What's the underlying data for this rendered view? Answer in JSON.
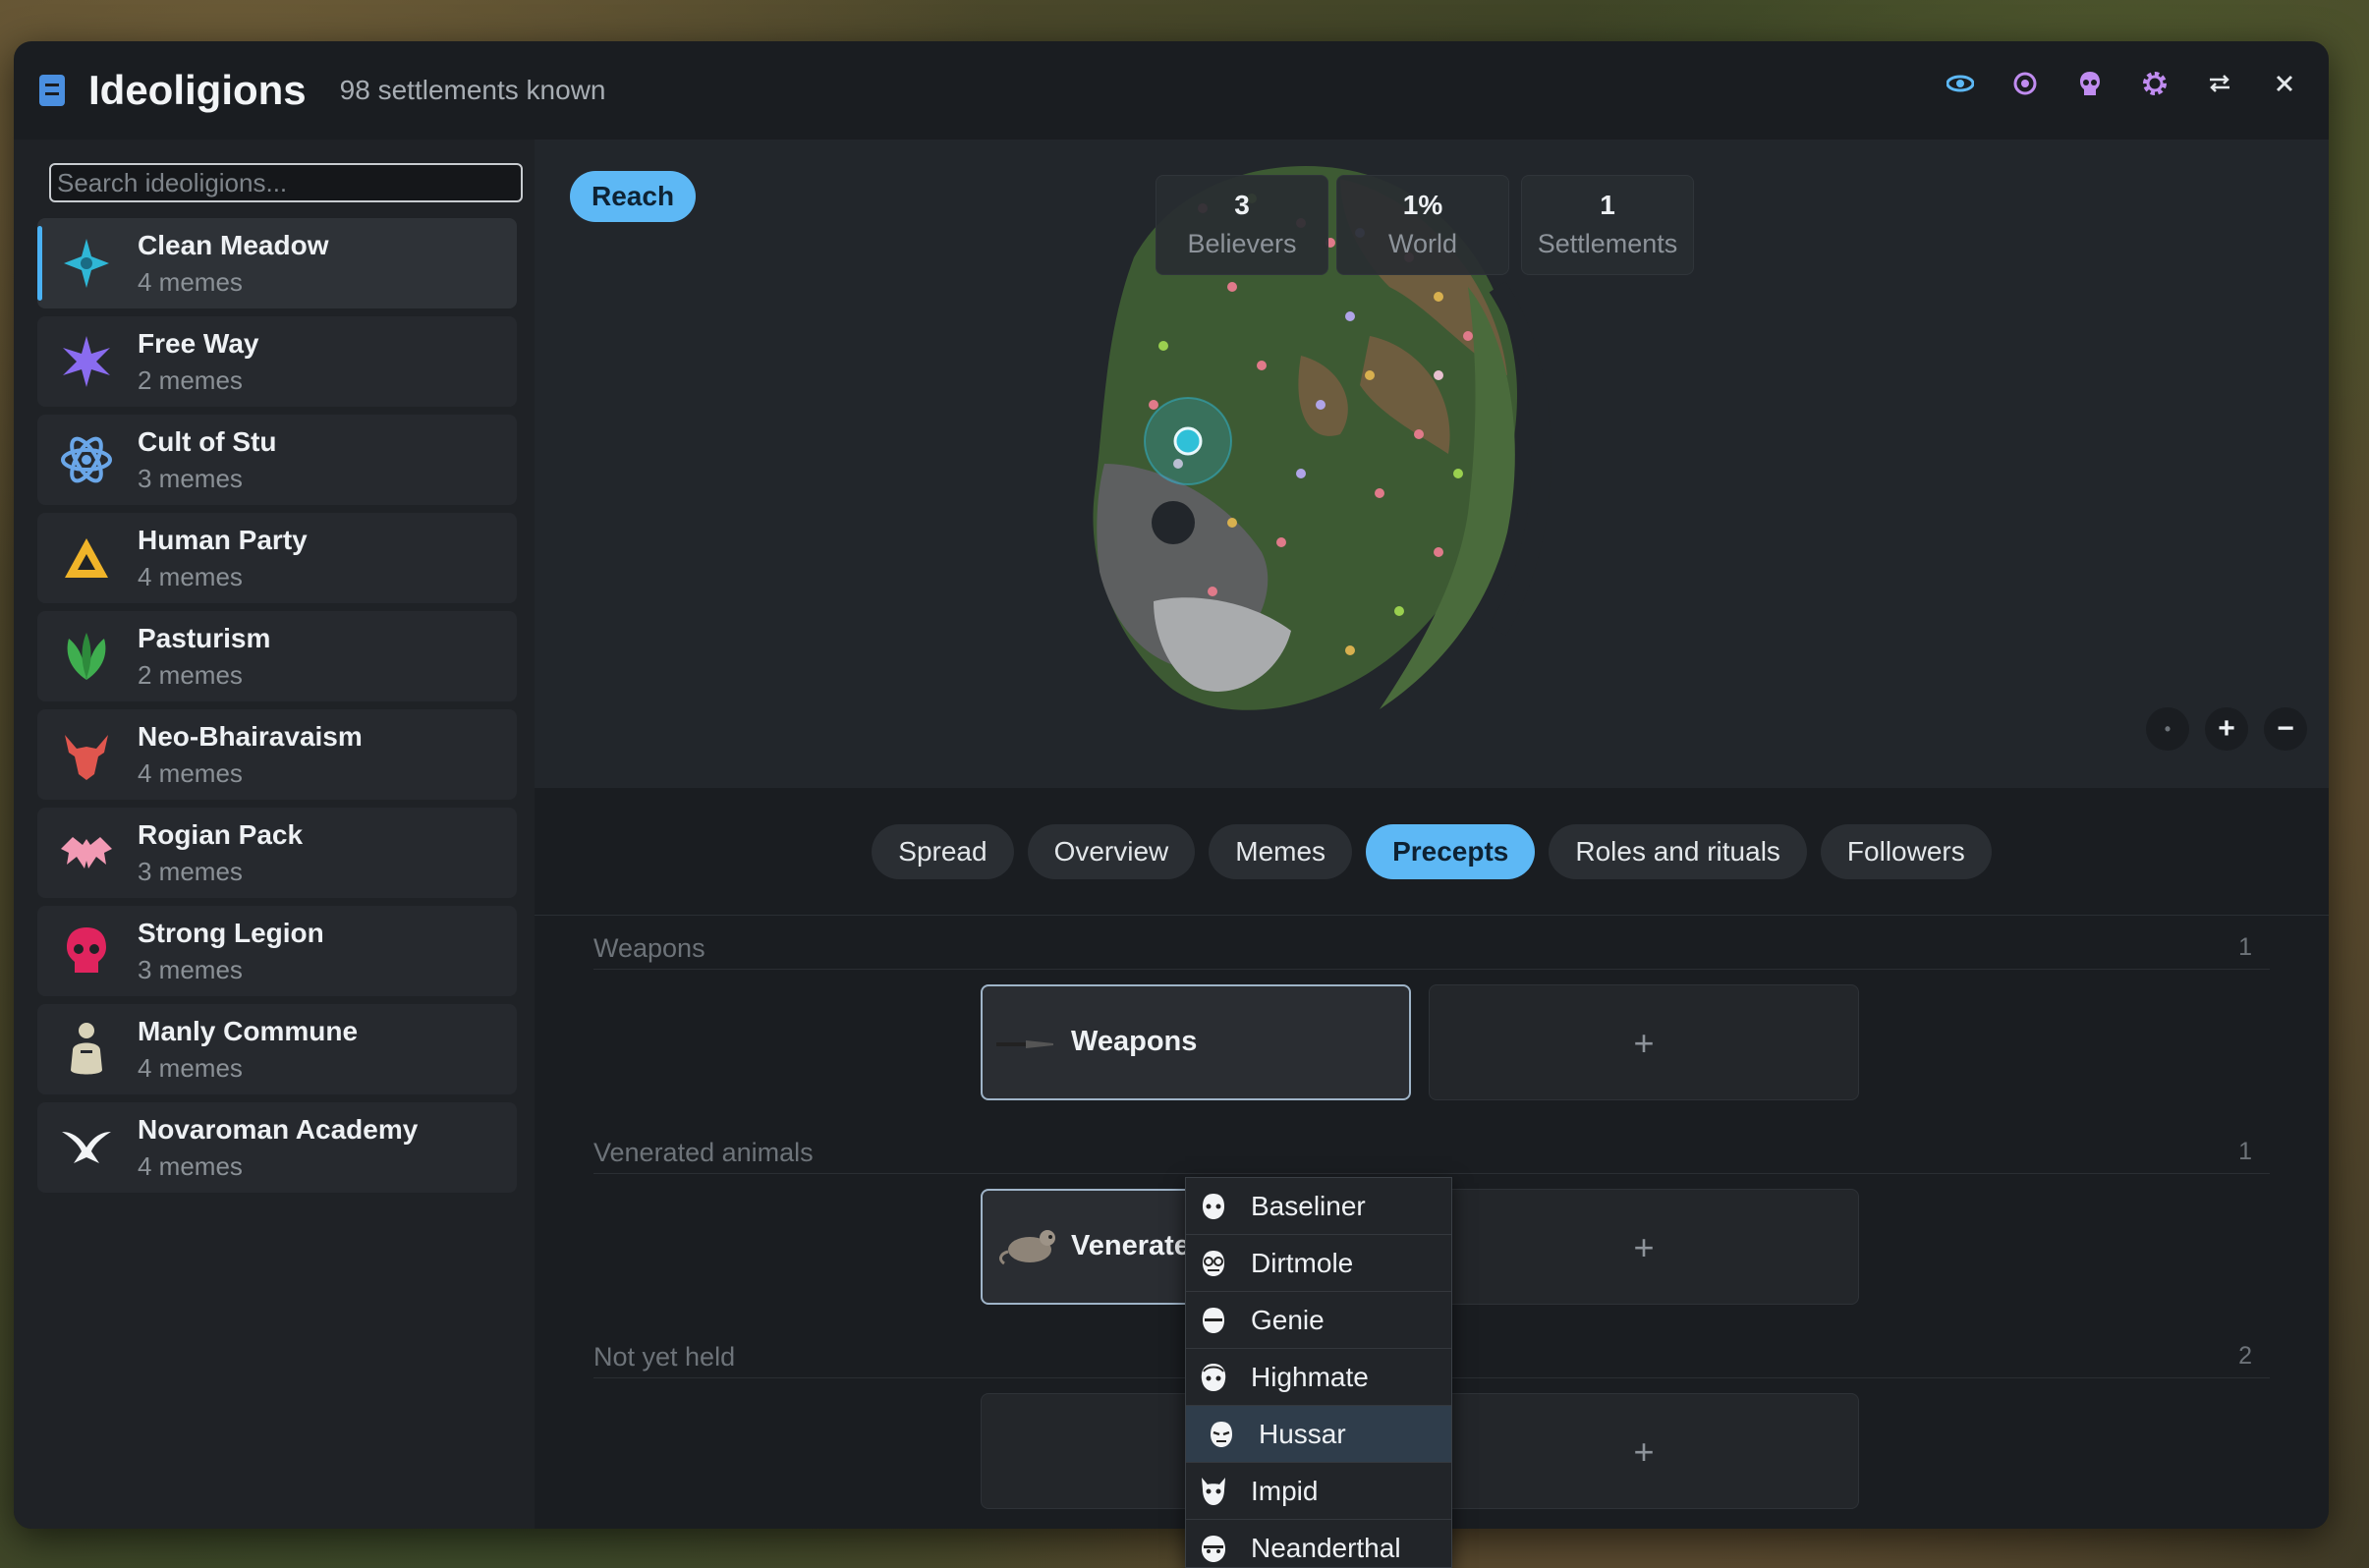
{
  "window": {
    "title": "Ideoligions",
    "subtitle": "98 settlements known",
    "actions": [
      {
        "icon": "eye-icon",
        "color": "#5db8f5"
      },
      {
        "icon": "target-icon",
        "color": "#c08cf0"
      },
      {
        "icon": "skull-icon",
        "color": "#c08cf0"
      },
      {
        "icon": "gear-icon",
        "color": "#c08cf0"
      },
      {
        "icon": "swap-icon",
        "color": "#e3e7ea"
      },
      {
        "icon": "close-icon",
        "color": "#e3e7ea"
      }
    ]
  },
  "search": {
    "placeholder": "Search ideoligions..."
  },
  "ideoligions": [
    {
      "name": "Clean Meadow",
      "memes": "4 memes",
      "icon": "cross-icon",
      "color": "#2fb7d6",
      "active": true
    },
    {
      "name": "Free Way",
      "memes": "2 memes",
      "icon": "star-icon",
      "color": "#8a6cf0",
      "active": false
    },
    {
      "name": "Cult of Stu",
      "memes": "3 memes",
      "icon": "atom-icon",
      "color": "#6aa6e8",
      "active": false
    },
    {
      "name": "Human Party",
      "memes": "4 memes",
      "icon": "triangle-icon",
      "color": "#f0b429",
      "active": false
    },
    {
      "name": "Pasturism",
      "memes": "2 memes",
      "icon": "leaf-icon",
      "color": "#3fae4f",
      "active": false
    },
    {
      "name": "Neo-Bhairavaism",
      "memes": "4 memes",
      "icon": "demon-icon",
      "color": "#e0564e",
      "active": false
    },
    {
      "name": "Rogian Pack",
      "memes": "3 memes",
      "icon": "bat-icon",
      "color": "#f29ab4",
      "active": false
    },
    {
      "name": "Strong Legion",
      "memes": "3 memes",
      "icon": "skull-icon",
      "color": "#e0245e",
      "active": false
    },
    {
      "name": "Manly Commune",
      "memes": "4 memes",
      "icon": "figure-icon",
      "color": "#d8d2b8",
      "active": false
    },
    {
      "name": "Novaroman Academy",
      "memes": "4 memes",
      "icon": "horns-icon",
      "color": "#f2f4f6",
      "active": false
    }
  ],
  "map": {
    "pill": "Reach",
    "stats": [
      {
        "value": "3",
        "label": "Believers"
      },
      {
        "value": "1%",
        "label": "World"
      },
      {
        "value": "1",
        "label": "Settlements"
      }
    ],
    "controls": [
      "•",
      "+",
      "−"
    ]
  },
  "tabs": [
    {
      "label": "Spread",
      "active": false
    },
    {
      "label": "Overview",
      "active": false
    },
    {
      "label": "Memes",
      "active": false
    },
    {
      "label": "Precepts",
      "active": true
    },
    {
      "label": "Roles and rituals",
      "active": false
    },
    {
      "label": "Followers",
      "active": false
    }
  ],
  "precepts": {
    "sections": [
      {
        "label": "Weapons",
        "count": "1",
        "card": "Weapons"
      },
      {
        "label": "Venerated animals",
        "count": "1",
        "card": "Venerate"
      },
      {
        "label": "Not yet held",
        "count": "2",
        "card": ""
      }
    ],
    "add_symbol": "+"
  },
  "dropdown": {
    "options": [
      "Baseliner",
      "Dirtmole",
      "Genie",
      "Highmate",
      "Hussar",
      "Impid",
      "Neanderthal"
    ],
    "highlighted": "Hussar"
  }
}
